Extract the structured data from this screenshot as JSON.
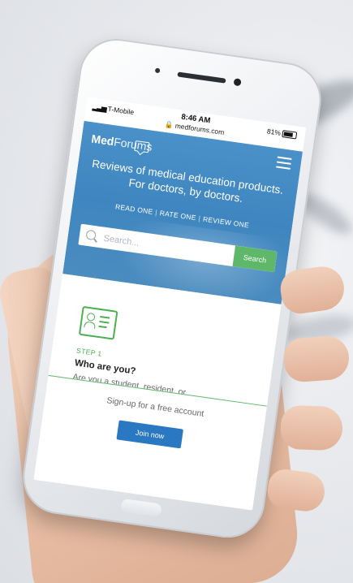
{
  "status_bar": {
    "carrier": "T-Mobile",
    "time": "8:46 AM",
    "url": "medforums.com",
    "battery": "81%"
  },
  "site": {
    "logo_bold": "Med",
    "logo_light": "Forums",
    "tagline": "Reviews of medical education products. For doctors, by doctors.",
    "nav": [
      "READ ONE",
      "RATE ONE",
      "REVIEW ONE"
    ],
    "search": {
      "placeholder": "Search...",
      "button_label": "Search"
    }
  },
  "step": {
    "label": "STEP 1",
    "title": "Who are you?",
    "description": "Are you a student, resident, or"
  },
  "cta": {
    "text": "Sign-up for a free account",
    "button_label": "Join now"
  },
  "colors": {
    "hero_blue": "#4a90c9",
    "accent_green": "#5fb86a",
    "button_blue": "#2a78c2"
  }
}
